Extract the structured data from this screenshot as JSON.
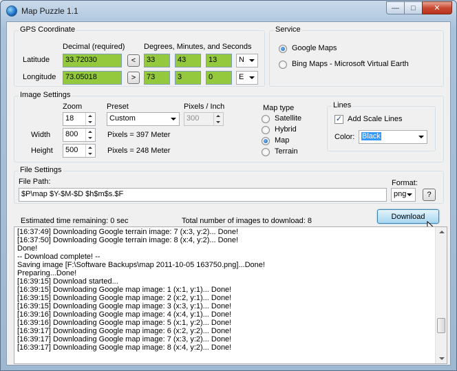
{
  "window": {
    "title": "Map Puzzle 1.1",
    "minimize": "—",
    "maximize": "□",
    "close": "✕"
  },
  "gps": {
    "group_label": "GPS Coordinate",
    "decimal_header": "Decimal (required)",
    "dms_header": "Degrees, Minutes, and Seconds",
    "latitude": {
      "label": "Latitude",
      "decimal": "33.72030",
      "arrow": "<",
      "deg": "33",
      "min": "43",
      "sec": "13",
      "hemi": "N"
    },
    "longitude": {
      "label": "Longitude",
      "decimal": "73.05018",
      "arrow": ">",
      "deg": "73",
      "min": "3",
      "sec": "0",
      "hemi": "E"
    }
  },
  "service": {
    "group_label": "Service",
    "options": [
      {
        "label": "Google Maps",
        "selected": true
      },
      {
        "label": "Bing Maps - Microsoft Virtual Earth",
        "selected": false
      }
    ]
  },
  "image_settings": {
    "group_label": "Image Settings",
    "zoom_label": "Zoom",
    "zoom_value": "18",
    "preset_label": "Preset",
    "preset_value": "Custom",
    "ppi_label": "Pixels / Inch",
    "ppi_value": "300",
    "width_label": "Width",
    "width_value": "800",
    "width_info": "Pixels = 397 Meter",
    "height_label": "Height",
    "height_value": "500",
    "height_info": "Pixels = 248 Meter",
    "map_type": {
      "label": "Map type",
      "options": [
        {
          "label": "Satellite",
          "selected": false
        },
        {
          "label": "Hybrid",
          "selected": false
        },
        {
          "label": "Map",
          "selected": true
        },
        {
          "label": "Terrain",
          "selected": false
        }
      ]
    },
    "lines": {
      "label": "Lines",
      "scale_lines_label": "Add Scale Lines",
      "scale_lines_checked": true,
      "color_label": "Color:",
      "color_value": "Black",
      "check_mark": "✓"
    }
  },
  "file_settings": {
    "group_label": "File Settings",
    "path_label": "File Path:",
    "path_value": "$P\\map $Y-$M-$D $h$m$s.$F",
    "format_label": "Format:",
    "format_value": "png",
    "help_label": "?"
  },
  "status": {
    "time_remaining": "Estimated time remaining: 0 sec",
    "total_images": "Total number of images to download: 8",
    "download_label": "Download"
  },
  "log": [
    "[16:37:49] Downloading Google terrain image: 7 (x:3, y:2)... Done!",
    "[16:37:50] Downloading Google terrain image: 8 (x:4, y:2)... Done!",
    "Done!",
    "-- Download complete! --",
    "Saving image [F:\\Software Backups\\map 2011-10-05 163750.png]...Done!",
    "Preparing...Done!",
    "[16:39:15] Download started...",
    "[16:39:15] Downloading Google map image: 1 (x:1, y:1)... Done!",
    "[16:39:15] Downloading Google map image: 2 (x:2, y:1)... Done!",
    "[16:39:15] Downloading Google map image: 3 (x:3, y:1)... Done!",
    "[16:39:16] Downloading Google map image: 4 (x:4, y:1)... Done!",
    "[16:39:16] Downloading Google map image: 5 (x:1, y:2)... Done!",
    "[16:39:17] Downloading Google map image: 6 (x:2, y:2)... Done!",
    "[16:39:17] Downloading Google map image: 7 (x:3, y:2)... Done!",
    "[16:39:17] Downloading Google map image: 8 (x:4, y:2)... Done!"
  ]
}
